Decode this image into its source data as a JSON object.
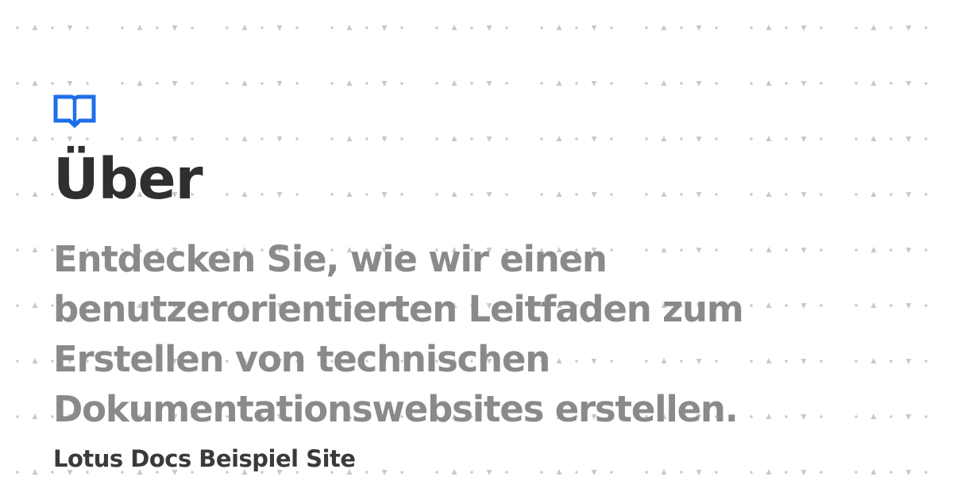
{
  "brand": {
    "icon": "book-open-icon",
    "accent": "#1f6feb"
  },
  "page": {
    "title": "Über",
    "description": "Entdecken Sie, wie wir einen benutzerorientierten Leitfaden zum Erstellen von technischen Dokumentationswebsites erstellen.",
    "site_name": "Lotus Docs Beispiel Site"
  },
  "colors": {
    "background": "#ffffff",
    "title": "#2f2f2f",
    "description": "#8a8a8a",
    "site_name": "#3a3a3a",
    "pattern": "#c9c9c9"
  }
}
